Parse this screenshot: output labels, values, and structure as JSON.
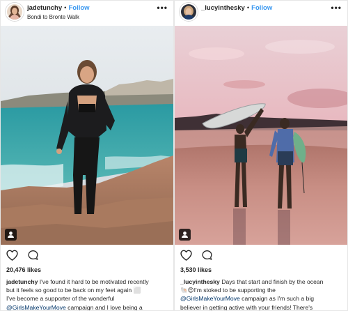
{
  "posts": [
    {
      "username": "jadetunchy",
      "follow_label": "Follow",
      "separator": "•",
      "location": "Bondi to Bronte Walk",
      "more_label": "•••",
      "likes": "20,476 likes",
      "caption": {
        "line1": "I've found it hard to be motivated recently",
        "line2": "but it feels so good to be back on my feet again ⬜",
        "line3": "I've become a supporter of the wonderful",
        "hashtag": "@GirlsMakeYourMove",
        "line4_rest": " campaign and I love being a"
      }
    },
    {
      "username": "_lucyinthesky",
      "follow_label": "Follow",
      "separator": "•",
      "more_label": "•••",
      "likes": "3,530 likes",
      "caption": {
        "line1": "Days that start and finish by the ocean",
        "line2_emoji": "🐚😍",
        "line2": "I'm stoked to be supporting the",
        "hashtag": "@GirlsMakeYourMove",
        "line3_rest": " campaign as I'm such a big",
        "line4": "believer in getting active with your friends! There's"
      }
    }
  ],
  "icons": {
    "heart": "heart-icon",
    "comment": "comment-icon",
    "tag": "person-tag-icon",
    "more": "more-options-icon"
  },
  "colors": {
    "link": "#3897f0",
    "hashtag": "#003569",
    "text": "#262626",
    "border": "#e6e6e6"
  }
}
